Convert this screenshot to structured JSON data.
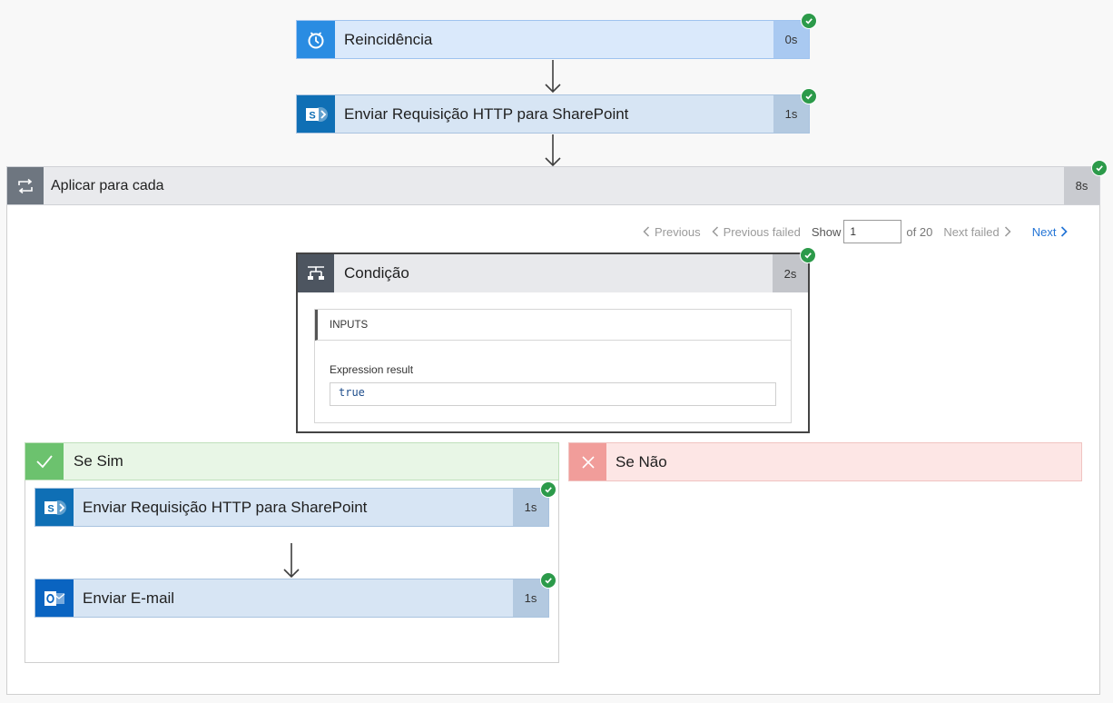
{
  "recurrence": {
    "title": "Reincidência",
    "duration": "0s"
  },
  "sharepoint_top": {
    "title": "Enviar Requisição HTTP para SharePoint",
    "duration": "1s"
  },
  "foreach": {
    "title": "Aplicar para cada",
    "duration": "8s"
  },
  "pager": {
    "previous": "Previous",
    "previous_failed": "Previous failed",
    "show": "Show",
    "show_value": "1",
    "of_total": "of 20",
    "next_failed": "Next failed",
    "next": "Next"
  },
  "condition": {
    "title": "Condição",
    "duration": "2s",
    "inputs_label": "INPUTS",
    "expression_label": "Expression result",
    "expression_value": "true"
  },
  "if_yes": {
    "title": "Se Sim",
    "sharepoint": {
      "title": "Enviar Requisição HTTP para SharePoint",
      "duration": "1s"
    },
    "email": {
      "title": "Enviar E-mail",
      "duration": "1s"
    }
  },
  "if_no": {
    "title": "Se Não"
  },
  "colors": {
    "success": "#2c9a4a",
    "yes_accent": "#6cc26e",
    "no_accent": "#f19d9a",
    "sharepoint": "#0f6fb5",
    "outlook": "#0a64c1",
    "recurrence": "#2a8ce2",
    "link": "#2475d6"
  }
}
